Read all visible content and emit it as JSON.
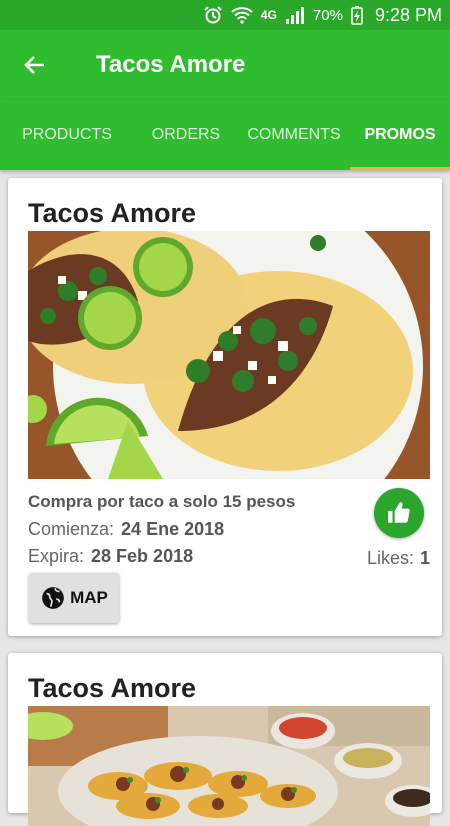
{
  "status_bar": {
    "battery": "70%",
    "network": "4G",
    "time": "9:28 PM"
  },
  "app_bar": {
    "title": "Tacos Amore"
  },
  "tabs": [
    {
      "label": "PRODUCTS"
    },
    {
      "label": "ORDERS"
    },
    {
      "label": "COMMENTS"
    },
    {
      "label": "PROMOS",
      "active": true
    }
  ],
  "promos": [
    {
      "title": "Tacos Amore",
      "description": "Compra por taco a solo 15 pesos",
      "start_label": "Comienza:",
      "start_date": "24 Ene 2018",
      "end_label": "Expira:",
      "end_date": "28 Feb 2018",
      "likes_label": "Likes:",
      "likes_count": "1",
      "map_label": "MAP"
    },
    {
      "title": "Tacos Amore"
    }
  ],
  "colors": {
    "primary": "#2fbd2f",
    "status_bar": "#2aa82a",
    "tab_indicator": "#f6b02b",
    "like_button": "#2ca52c"
  }
}
